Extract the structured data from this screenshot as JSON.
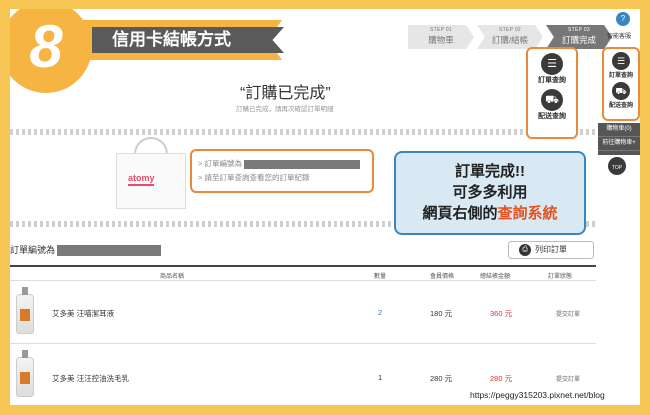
{
  "badge_number": "8",
  "banner_title": "信用卡結帳方式",
  "steps": [
    {
      "num": "STEP 01",
      "label": "購物車"
    },
    {
      "num": "STEP 02",
      "label": "訂購/結帳"
    },
    {
      "num": "STEP 03",
      "label": "訂購完成"
    }
  ],
  "complete": {
    "title": "“訂購已完成”",
    "subtitle": "訂購已完成，請再次確認訂單明細"
  },
  "bag_logo": "atomy",
  "info": {
    "order_no_label": "> 訂單編號為",
    "check_hint": "> 請至訂單查詢查看您的訂單紀錄"
  },
  "callout": {
    "line1": "訂單完成!!",
    "line2": "可多多利用",
    "line3_prefix": "網頁右側的",
    "line3_highlight": "查詢系統"
  },
  "side_panel": {
    "help_label": "智能客服",
    "help_icon": "?",
    "order_query": "訂單查詢",
    "delivery_query": "配送查詢",
    "cart": "購物車(0)",
    "go_cart": "前往購物車+",
    "top": "TOP"
  },
  "order_list": {
    "heading": "訂單編號為",
    "print_label": "列印訂單",
    "headers": {
      "name": "商品名稱",
      "qty": "數量",
      "price": "會員價格",
      "total": "總結帳金額",
      "status": "訂單狀態"
    },
    "rows": [
      {
        "name": "艾多美 汪喵潔耳液",
        "qty": "2",
        "price": "180 元",
        "total": "360 元",
        "status": "提交訂單"
      },
      {
        "name": "艾多美 汪汪控油洗毛乳",
        "qty": "1",
        "price": "280 元",
        "total": "280 元",
        "status": "提交訂單"
      }
    ]
  },
  "url": "https://peggy315203.pixnet.net/blog"
}
